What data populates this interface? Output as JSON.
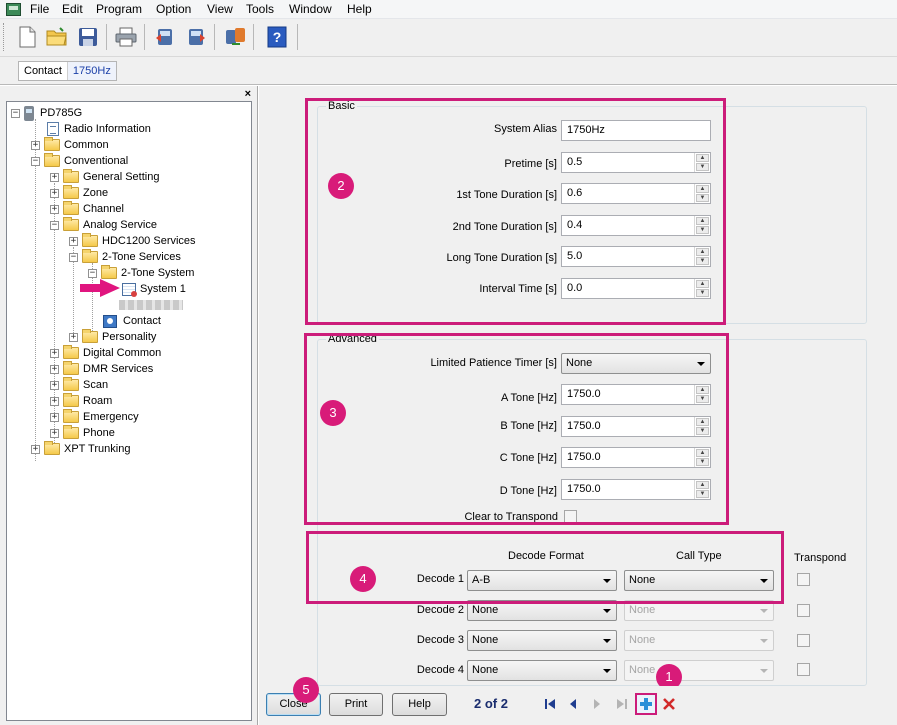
{
  "menu": [
    "File",
    "Edit",
    "Program",
    "Option",
    "View",
    "Tools",
    "Window",
    "Help"
  ],
  "tab": {
    "label": "Contact",
    "value": "1750Hz"
  },
  "tree": {
    "root": "PD785G",
    "radio_information": "Radio Information",
    "common": "Common",
    "conventional": "Conventional",
    "general_setting": "General Setting",
    "zone": "Zone",
    "channel": "Channel",
    "analog_service": "Analog Service",
    "hdc1200": "HDC1200 Services",
    "two_tone_services": "2-Tone Services",
    "two_tone_system": "2-Tone System",
    "system1": "System 1",
    "contact": "Contact",
    "personality": "Personality",
    "digital_common": "Digital Common",
    "dmr_services": "DMR Services",
    "scan": "Scan",
    "roam": "Roam",
    "emergency": "Emergency",
    "phone": "Phone",
    "xpt_trunking": "XPT Trunking"
  },
  "basic": {
    "title": "Basic",
    "system_alias_label": "System Alias",
    "system_alias": "1750Hz",
    "pretime_label": "Pretime [s]",
    "pretime": "0.5",
    "tone1_label": "1st Tone Duration [s]",
    "tone1": "0.6",
    "tone2_label": "2nd Tone Duration [s]",
    "tone2": "0.4",
    "long_tone_label": "Long Tone Duration [s]",
    "long_tone": "5.0",
    "interval_label": "Interval Time [s]",
    "interval": "0.0"
  },
  "advanced": {
    "title": "Advanced",
    "patience_label": "Limited Patience Timer [s]",
    "patience": "None",
    "a_tone_label": "A Tone [Hz]",
    "a_tone": "1750.0",
    "b_tone_label": "B Tone [Hz]",
    "b_tone": "1750.0",
    "c_tone_label": "C Tone [Hz]",
    "c_tone": "1750.0",
    "d_tone_label": "D Tone [Hz]",
    "d_tone": "1750.0",
    "clear_label": "Clear to Transpond"
  },
  "decode": {
    "format_header": "Decode Format",
    "call_type_header": "Call Type",
    "transpond_header": "Transpond",
    "rows": [
      {
        "label": "Decode 1",
        "format": "A-B",
        "call_type": "None"
      },
      {
        "label": "Decode 2",
        "format": "None",
        "call_type": "None"
      },
      {
        "label": "Decode 3",
        "format": "None",
        "call_type": "None"
      },
      {
        "label": "Decode 4",
        "format": "None",
        "call_type": "None"
      }
    ]
  },
  "bottom": {
    "close": "Close",
    "print": "Print",
    "help": "Help",
    "pager": "2 of 2"
  },
  "annotations": [
    "1",
    "2",
    "3",
    "4",
    "5"
  ],
  "colors": {
    "annotation": "#cc1c7a",
    "accent": "#1a3fa8"
  }
}
